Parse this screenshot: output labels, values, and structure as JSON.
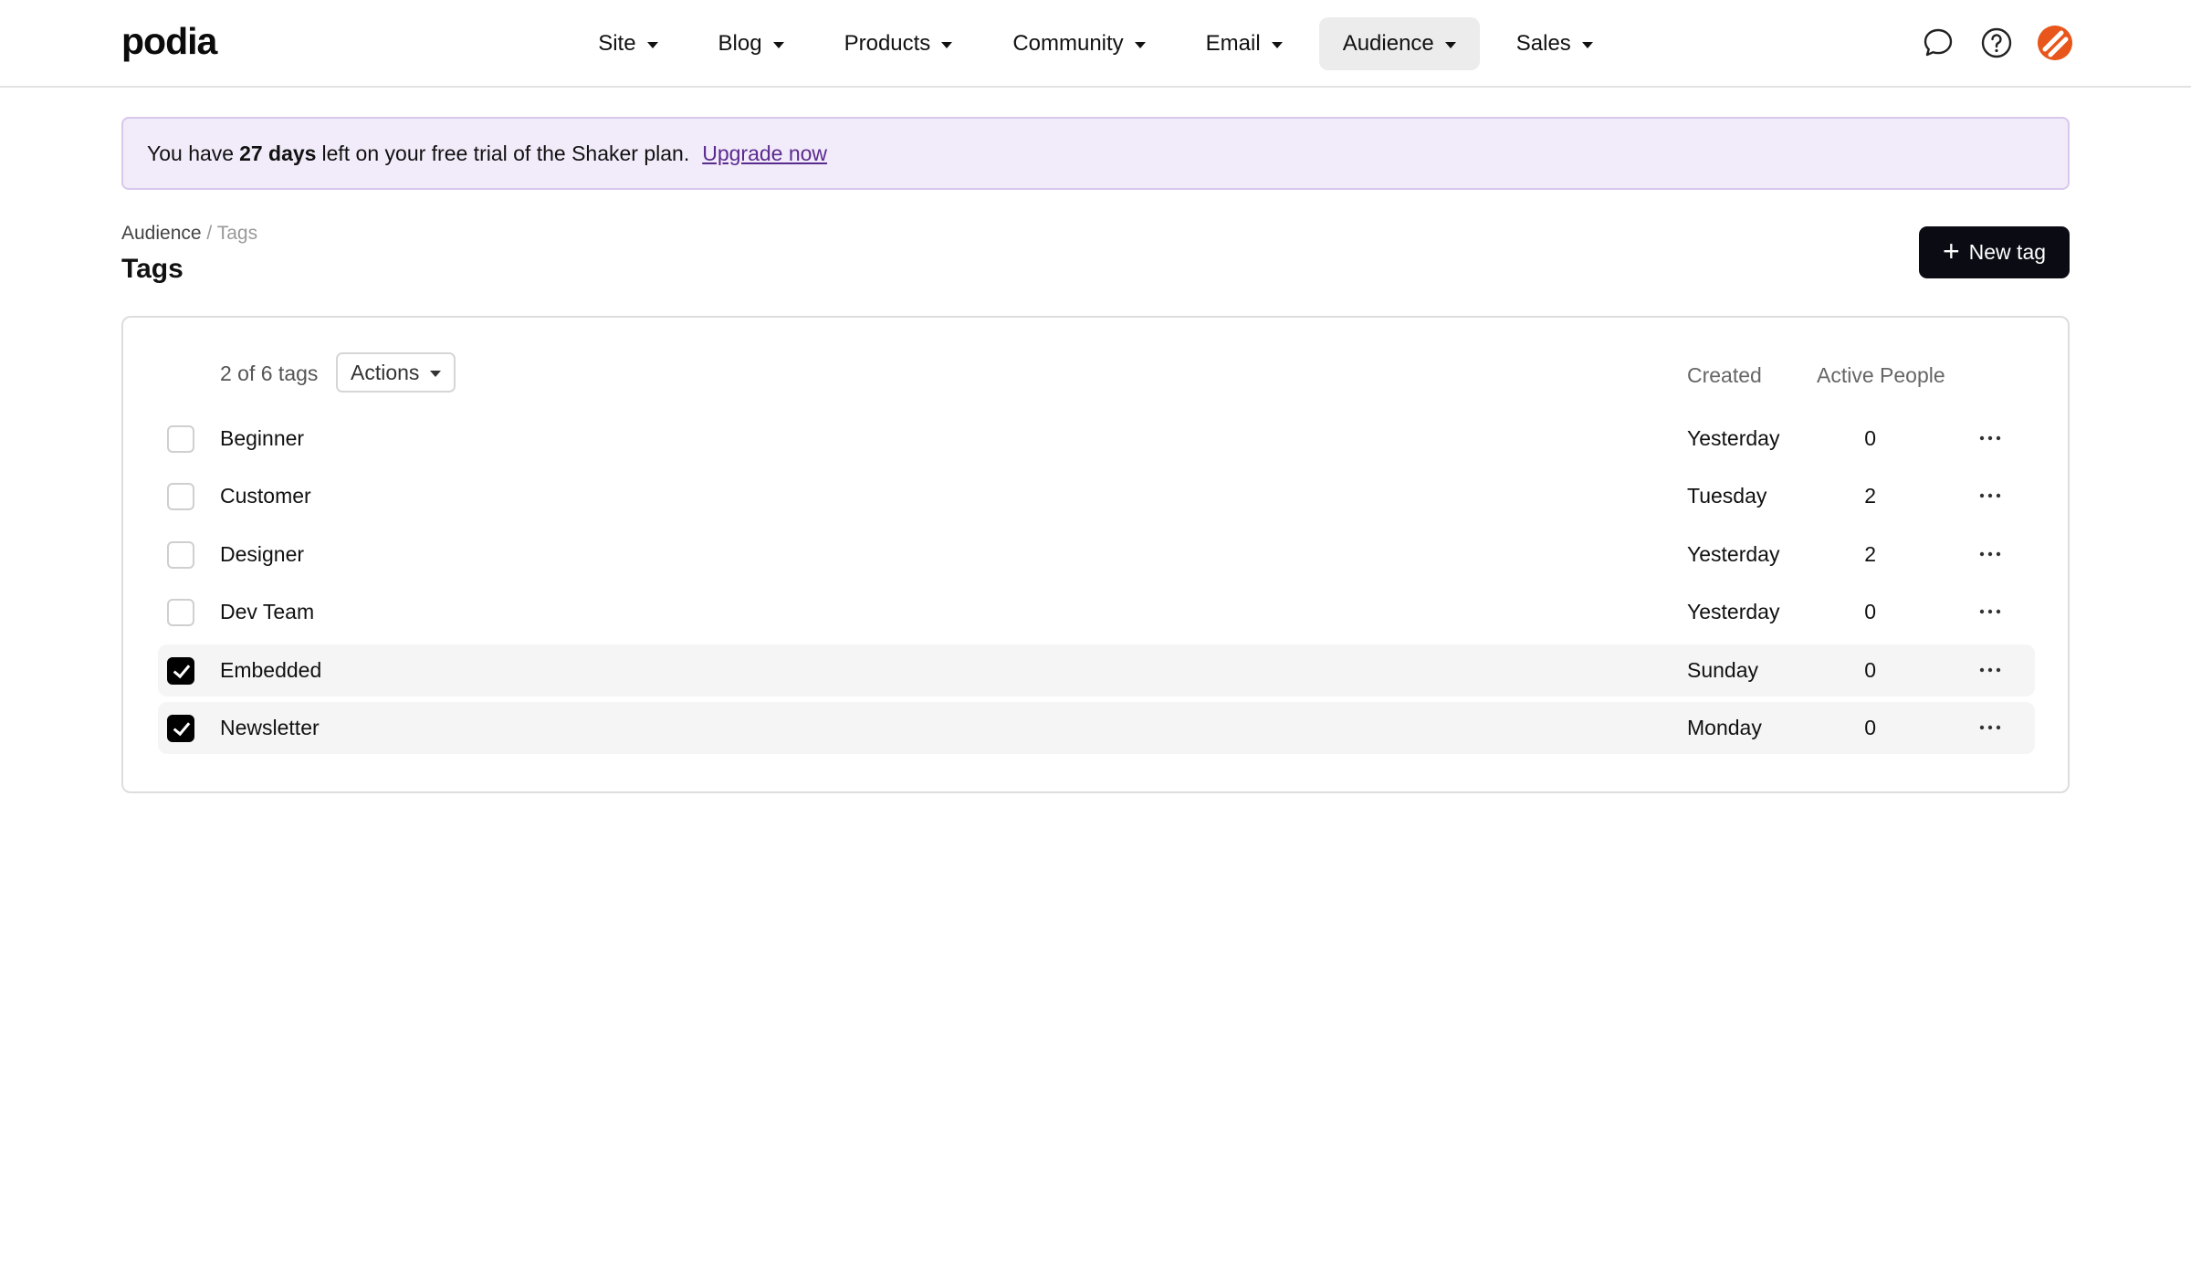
{
  "brand": "podia",
  "nav": [
    {
      "label": "Site",
      "active": false
    },
    {
      "label": "Blog",
      "active": false
    },
    {
      "label": "Products",
      "active": false
    },
    {
      "label": "Community",
      "active": false
    },
    {
      "label": "Email",
      "active": false
    },
    {
      "label": "Audience",
      "active": true
    },
    {
      "label": "Sales",
      "active": false
    }
  ],
  "top_icons": [
    "chat-icon",
    "help-icon",
    "avatar"
  ],
  "banner": {
    "prefix": "You have",
    "days": "27 days",
    "suffix": "left on your free trial of the Shaker plan.",
    "link": "Upgrade now"
  },
  "breadcrumb": {
    "parent": "Audience",
    "separator": "/",
    "current": "Tags"
  },
  "page_title": "Tags",
  "new_tag_label": "New tag",
  "table": {
    "count_text": "2 of 6 tags",
    "actions_label": "Actions",
    "headers": {
      "created": "Created",
      "active_people": "Active People"
    },
    "rows": [
      {
        "name": "Beginner",
        "created": "Yesterday",
        "active_people": "0",
        "checked": false
      },
      {
        "name": "Customer",
        "created": "Tuesday",
        "active_people": "2",
        "checked": false
      },
      {
        "name": "Designer",
        "created": "Yesterday",
        "active_people": "2",
        "checked": false
      },
      {
        "name": "Dev Team",
        "created": "Yesterday",
        "active_people": "0",
        "checked": false
      },
      {
        "name": "Embedded",
        "created": "Sunday",
        "active_people": "0",
        "checked": true
      },
      {
        "name": "Newsletter",
        "created": "Monday",
        "active_people": "0",
        "checked": true
      }
    ]
  },
  "colors": {
    "banner_bg": "#f2ebf9",
    "banner_border": "#d8c8ec",
    "link": "#5a2b8f",
    "primary_button": "#0b0b14",
    "avatar": "#e8561b",
    "selected_row": "#f5f5f5"
  }
}
